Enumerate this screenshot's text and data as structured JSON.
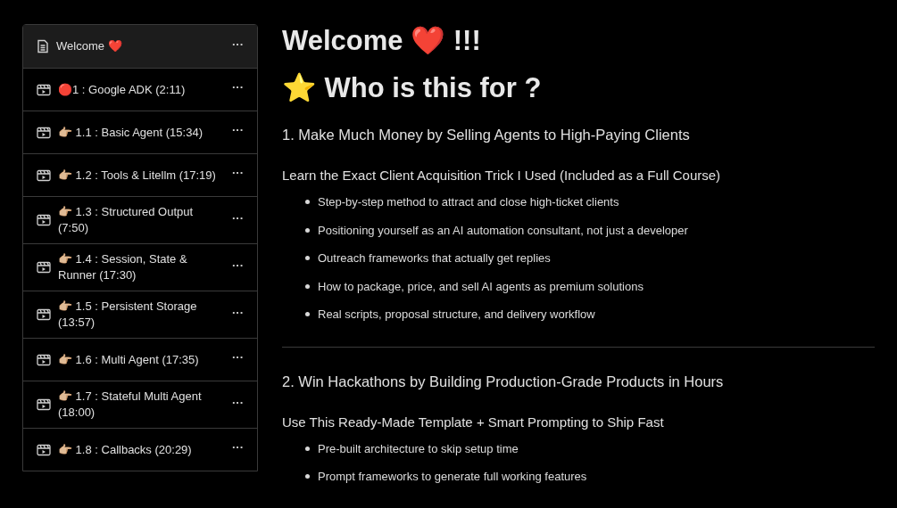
{
  "sidebar": {
    "items": [
      {
        "kind": "page",
        "label": "Welcome ❤️",
        "selected": true,
        "menu": "···"
      },
      {
        "kind": "video",
        "label": "🔴1 : Google ADK (2:11)",
        "selected": false,
        "menu": "···"
      },
      {
        "kind": "video",
        "label": "👉🏼 1.1 : Basic Agent (15:34)",
        "selected": false,
        "menu": "···"
      },
      {
        "kind": "video",
        "label": "👉🏼 1.2 : Tools & Litellm (17:19)",
        "selected": false,
        "menu": "···"
      },
      {
        "kind": "video",
        "label": "👉🏼 1.3 : Structured Output (7:50)",
        "selected": false,
        "menu": "···"
      },
      {
        "kind": "video",
        "label": "👉🏼 1.4 : Session, State & Runner (17:30)",
        "selected": false,
        "menu": "···"
      },
      {
        "kind": "video",
        "label": "👉🏼 1.5 : Persistent Storage (13:57)",
        "selected": false,
        "menu": "···"
      },
      {
        "kind": "video",
        "label": "👉🏼 1.6 : Multi Agent (17:35)",
        "selected": false,
        "menu": "···"
      },
      {
        "kind": "video",
        "label": "👉🏼 1.7 : Stateful Multi Agent (18:00)",
        "selected": false,
        "menu": "···"
      },
      {
        "kind": "video",
        "label": "👉🏼 1.8 : Callbacks (20:29)",
        "selected": false,
        "menu": "···"
      }
    ]
  },
  "content": {
    "title": "Welcome ❤️ !!!",
    "subtitle": "⭐ Who is this for ?",
    "sections": [
      {
        "heading": "1. Make Much Money by Selling Agents to High-Paying Clients",
        "subheading": "Learn the Exact Client Acquisition Trick I Used (Included as a Full Course)",
        "bullets": [
          "Step-by-step method to attract and close high-ticket clients",
          "Positioning yourself as an AI automation consultant, not just a developer",
          "Outreach frameworks that actually get replies",
          "How to package, price, and sell AI agents as premium solutions",
          "Real scripts, proposal structure, and delivery workflow"
        ]
      },
      {
        "heading": "2. Win Hackathons by Building Production-Grade Products in Hours",
        "subheading": "Use This Ready-Made Template + Smart Prompting to Ship Fast",
        "bullets": [
          "Pre-built architecture to skip setup time",
          "Prompt frameworks to generate full working features"
        ]
      }
    ]
  }
}
